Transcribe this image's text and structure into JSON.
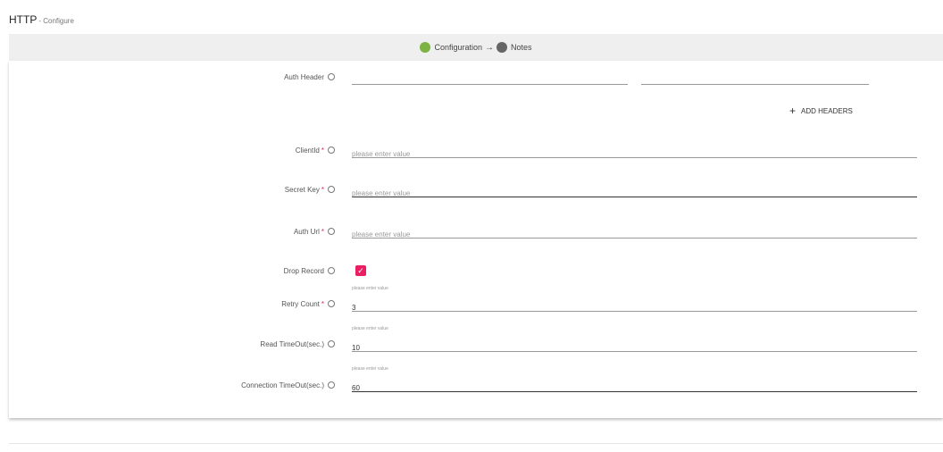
{
  "header": {
    "title": "HTTP",
    "subtitle": "- Configure"
  },
  "stepper": {
    "steps": [
      {
        "label": "Configuration",
        "color": "#7cb342"
      },
      {
        "label": "Notes",
        "color": "#666666"
      }
    ],
    "arrow": "→"
  },
  "form": {
    "auth_header": {
      "label": "Auth Header",
      "key_value": "",
      "value_value": ""
    },
    "add_headers_label": "ADD HEADERS",
    "client_id": {
      "label": "ClientId",
      "required_mark": "*",
      "placeholder": "please enter value",
      "value": ""
    },
    "secret_key": {
      "label": "Secret Key",
      "required_mark": "*",
      "placeholder": "please enter value",
      "value": ""
    },
    "auth_url": {
      "label": "Auth Url",
      "required_mark": "*",
      "placeholder": "please enter value",
      "value": ""
    },
    "drop_record": {
      "label": "Drop Record",
      "checked": true
    },
    "retry_count": {
      "label": "Retry Count",
      "required_mark": "*",
      "hint": "please enter value",
      "value": "3"
    },
    "read_timeout": {
      "label": "Read TimeOut(sec.)",
      "hint": "please enter value",
      "value": "10"
    },
    "connection_timeout": {
      "label": "Connection TimeOut(sec.)",
      "hint": "please enter value",
      "value": "60"
    }
  },
  "colors": {
    "accent": "#e91e63",
    "step_active": "#7cb342",
    "step_inactive": "#666666"
  }
}
